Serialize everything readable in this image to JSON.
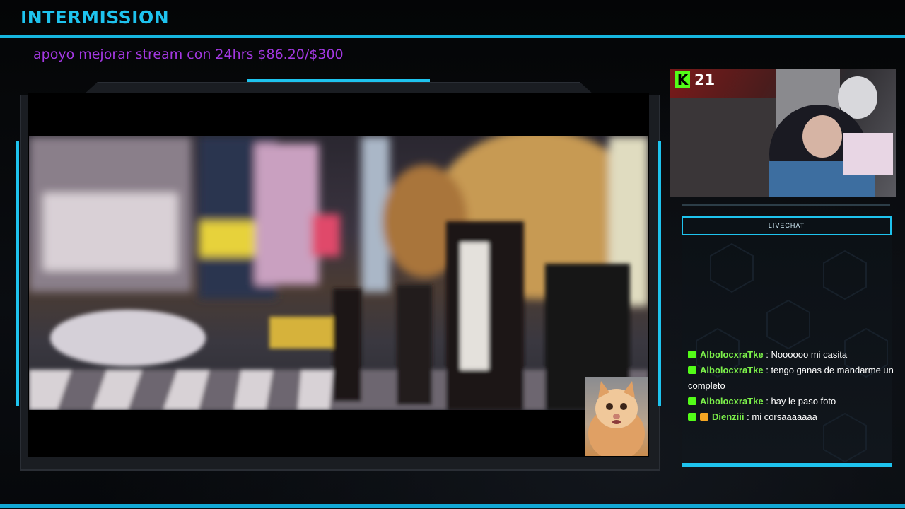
{
  "header": {
    "title": "INTERMISSION"
  },
  "goal": {
    "text": "apoyo mejorar stream con 24hrs $86.20/$300"
  },
  "webcam": {
    "viewer_count": "21",
    "platform_logo": "K"
  },
  "chat": {
    "header_label": "LIVECHAT",
    "messages": [
      {
        "user": "AlbolocxraTke",
        "text": "Noooooo mi casita",
        "badges": [
          "sub-badge"
        ]
      },
      {
        "user": "AlbolocxraTke",
        "text": "tengo ganas de mandarme un completo",
        "badges": [
          "sub-badge"
        ]
      },
      {
        "user": "AlbolocxraTke",
        "text": "hay le paso foto",
        "badges": [
          "sub-badge"
        ]
      },
      {
        "user": "Dienziii",
        "text": "mi corsaaaaaaa",
        "badges": [
          "sub-badge",
          "gift-badge"
        ]
      }
    ]
  },
  "colors": {
    "accent": "#1ec3ee",
    "goal_text": "#a338e2",
    "kick_green": "#53fc18",
    "chat_username": "#7cf04a"
  }
}
